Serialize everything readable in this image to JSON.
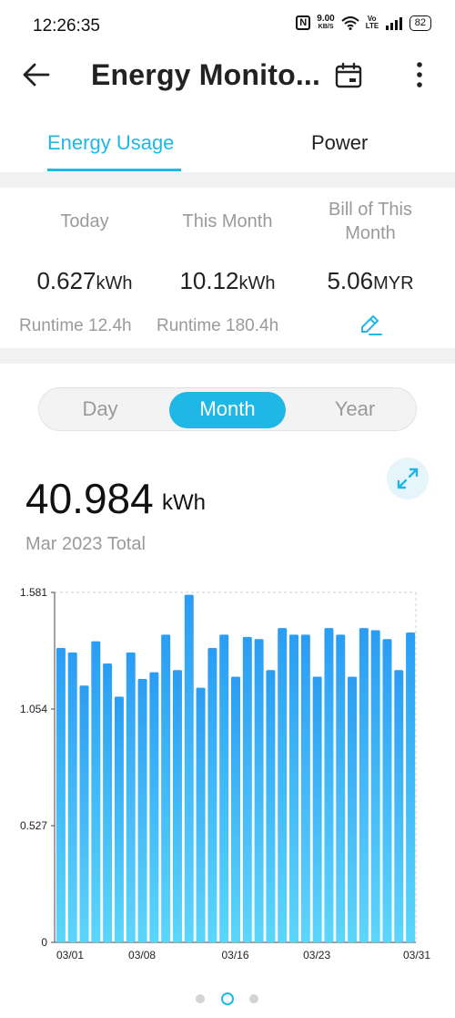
{
  "status_bar": {
    "time": "12:26:35",
    "nfc": "N",
    "speed_value": "9.00",
    "speed_unit": "KB/S",
    "volte": "Vo LTE",
    "battery": "82"
  },
  "header": {
    "title": "Energy Monito...",
    "icons": [
      "back-arrow-icon",
      "calendar-icon",
      "more-vertical-icon"
    ]
  },
  "tabs": [
    {
      "label": "Energy Usage",
      "active": true
    },
    {
      "label": "Power",
      "active": false
    }
  ],
  "stats": {
    "today": {
      "label": "Today",
      "value": "0.627",
      "unit": "kWh",
      "runtime": "Runtime 12.4h"
    },
    "this_month": {
      "label": "This Month",
      "value": "10.12",
      "unit": "kWh",
      "runtime": "Runtime 180.4h"
    },
    "bill": {
      "label_line1": "Bill of This",
      "label_line2": "Month",
      "value": "5.06",
      "unit": "MYR",
      "edit_icon": "edit-pencil-icon"
    }
  },
  "period_selector": {
    "options": [
      "Day",
      "Month",
      "Year"
    ],
    "selected": "Month"
  },
  "total": {
    "value": "40.984",
    "unit": "kWh",
    "caption": "Mar 2023 Total",
    "expand_icon": "expand-icon"
  },
  "colors": {
    "accent": "#1fb7e6",
    "bar_top": "#2a9df4",
    "bar_bottom": "#5bd6fb"
  },
  "chart_data": {
    "type": "bar",
    "title": "",
    "xlabel": "",
    "ylabel": "",
    "ylim": [
      0,
      1.581
    ],
    "y_ticks": [
      "0",
      "0.527",
      "1.054",
      "1.581"
    ],
    "x_tick_labels": [
      "03/01",
      "03/08",
      "03/16",
      "03/23",
      "03/31"
    ],
    "categories": [
      "03/01",
      "03/02",
      "03/03",
      "03/04",
      "03/05",
      "03/06",
      "03/07",
      "03/08",
      "03/09",
      "03/10",
      "03/11",
      "03/12",
      "03/13",
      "03/14",
      "03/15",
      "03/16",
      "03/17",
      "03/18",
      "03/19",
      "03/20",
      "03/21",
      "03/22",
      "03/23",
      "03/24",
      "03/25",
      "03/26",
      "03/27",
      "03/28",
      "03/29",
      "03/30",
      "03/31"
    ],
    "values": [
      1.33,
      1.31,
      1.16,
      1.36,
      1.26,
      1.11,
      1.31,
      1.19,
      1.22,
      1.39,
      1.23,
      1.57,
      1.15,
      1.33,
      1.39,
      1.2,
      1.38,
      1.37,
      1.23,
      1.42,
      1.39,
      1.39,
      1.2,
      1.42,
      1.39,
      1.2,
      1.42,
      1.41,
      1.37,
      1.23,
      1.4
    ],
    "grid": "dashed top and right border"
  },
  "pager": {
    "count": 3,
    "active_index": 1
  }
}
